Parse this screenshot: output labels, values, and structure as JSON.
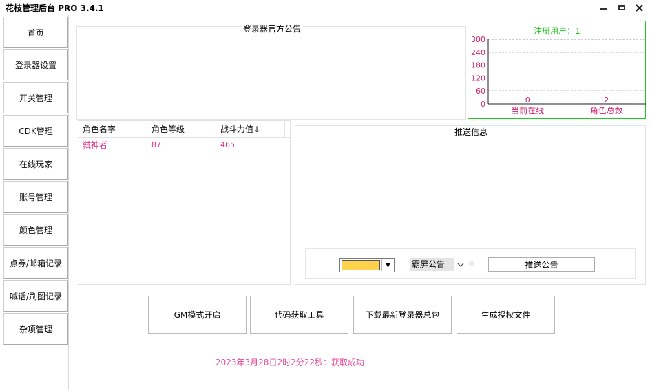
{
  "window": {
    "title": "花枝管理后台 PRO 3.4.1"
  },
  "sidebar": {
    "items": [
      {
        "label": "首页"
      },
      {
        "label": "登录器设置"
      },
      {
        "label": "开关管理"
      },
      {
        "label": "CDK管理"
      },
      {
        "label": "在线玩家"
      },
      {
        "label": "账号管理"
      },
      {
        "label": "颜色管理"
      },
      {
        "label": "点券/邮箱记录"
      },
      {
        "label": "喊话/刷图记录"
      },
      {
        "label": "杂项管理"
      }
    ]
  },
  "announcement": {
    "title": "登录器官方公告"
  },
  "chart_data": {
    "type": "bar",
    "title": "注册用户：1",
    "categories": [
      "当前在线",
      "角色总数"
    ],
    "values": [
      0,
      2
    ],
    "ylim": [
      0,
      300
    ],
    "yticks": [
      0,
      60,
      120,
      180,
      240,
      300
    ],
    "grid": true,
    "colors": {
      "axis_text": "#d0246e",
      "title": "#19c519",
      "grid": "#777777"
    }
  },
  "player_table": {
    "columns": [
      "角色名字",
      "角色等级",
      "战斗力值↓"
    ],
    "rows": [
      [
        "弑神者",
        "87",
        "465"
      ]
    ]
  },
  "push": {
    "title": "推送信息",
    "selected_color": "#ffd24d",
    "type_value": "霸屏公告",
    "send_label": "推送公告"
  },
  "actions": [
    {
      "label": "GM模式开启"
    },
    {
      "label": "代码获取工具"
    },
    {
      "label": "下载最新登录器总包"
    },
    {
      "label": "生成授权文件"
    }
  ],
  "status": {
    "text": "2023年3月28日2时2分22秒：获取成功"
  }
}
